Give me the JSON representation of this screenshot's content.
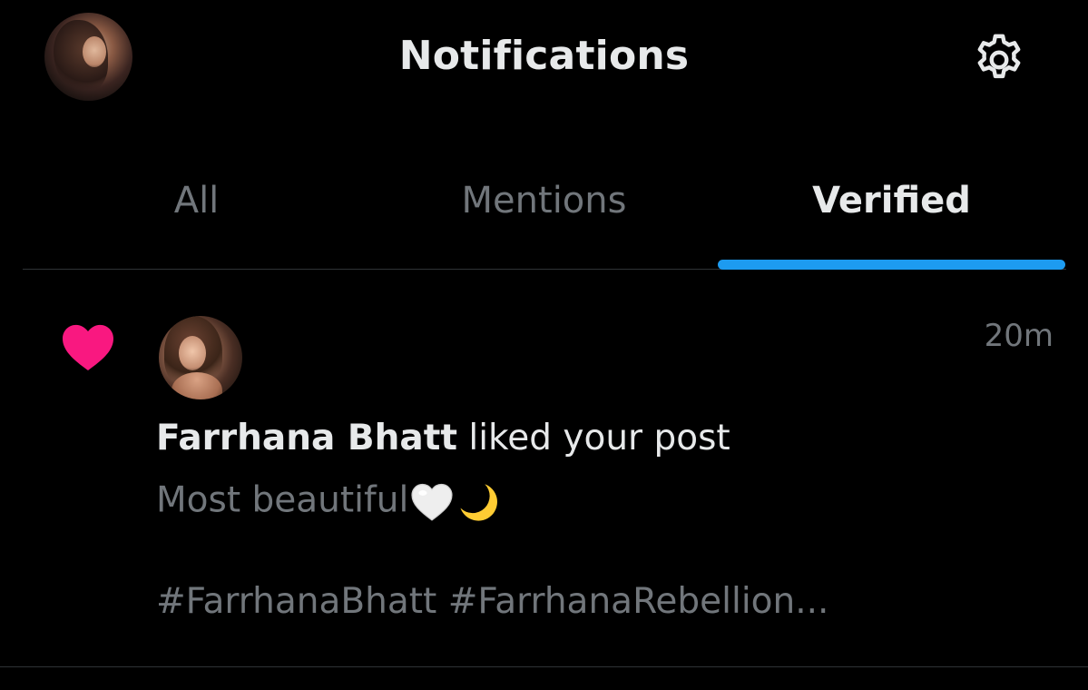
{
  "header": {
    "title": "Notifications",
    "avatar_icon": "profile-avatar",
    "settings_icon": "gear-icon"
  },
  "tabs": [
    {
      "label": "All",
      "active": false
    },
    {
      "label": "Mentions",
      "active": false
    },
    {
      "label": "Verified",
      "active": true
    }
  ],
  "colors": {
    "background": "#000000",
    "accent": "#1d9bf0",
    "like": "#f91880",
    "primary_text": "#e7e9ea",
    "secondary_text": "#71767b",
    "divider": "#2f3336"
  },
  "notification": {
    "type_icon": "heart-icon",
    "user_name": "Farrhana Bhatt",
    "action_text": " liked your post",
    "time": "20m",
    "post_text_line1": "Most beautiful",
    "post_emojis": [
      "white-heart-emoji",
      "crescent-moon-emoji"
    ],
    "post_text_line2": "#FarrhanaBhatt #FarrhanaRebellion..."
  }
}
